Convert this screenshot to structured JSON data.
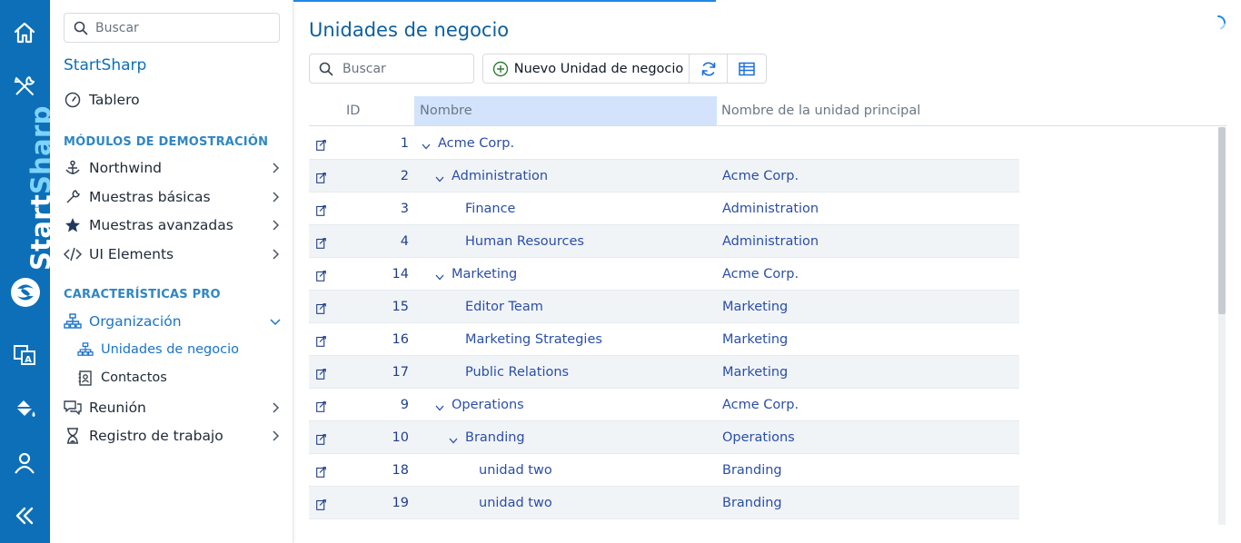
{
  "rail": {
    "brand_part1": "Start",
    "brand_part2": "Sharp",
    "icons": [
      "home-icon",
      "tools-icon",
      "translate-icon",
      "paint-bucket-icon",
      "user-icon",
      "collapse-icon"
    ]
  },
  "sidebar": {
    "search_placeholder": "Buscar",
    "app_name": "StartSharp",
    "dashboard": "Tablero",
    "section_demo": "MÓDULOS DE DEMOSTRACIÓN",
    "demo_items": [
      "Northwind",
      "Muestras básicas",
      "Muestras avanzadas",
      "UI Elements"
    ],
    "section_pro": "CARACTERÍSTICAS PRO",
    "org": "Organización",
    "org_items": [
      "Unidades de negocio",
      "Contactos"
    ],
    "pro_items": [
      "Reunión",
      "Registro de trabajo"
    ]
  },
  "page": {
    "title": "Unidades de negocio",
    "search_placeholder": "Buscar",
    "new_button": "Nuevo Unidad de negocio"
  },
  "grid": {
    "columns": [
      "ID",
      "Nombre",
      "Nombre de la unidad principal"
    ],
    "rows": [
      {
        "id": "1",
        "name": "Acme Corp.",
        "parent": "",
        "level": 0,
        "expander": true
      },
      {
        "id": "2",
        "name": "Administration",
        "parent": "Acme Corp.",
        "level": 1,
        "expander": true
      },
      {
        "id": "3",
        "name": "Finance",
        "parent": "Administration",
        "level": 2,
        "expander": false
      },
      {
        "id": "4",
        "name": "Human Resources",
        "parent": "Administration",
        "level": 2,
        "expander": false
      },
      {
        "id": "14",
        "name": "Marketing",
        "parent": "Acme Corp.",
        "level": 1,
        "expander": true
      },
      {
        "id": "15",
        "name": "Editor Team",
        "parent": "Marketing",
        "level": 2,
        "expander": false
      },
      {
        "id": "16",
        "name": "Marketing Strategies",
        "parent": "Marketing",
        "level": 2,
        "expander": false
      },
      {
        "id": "17",
        "name": "Public Relations",
        "parent": "Marketing",
        "level": 2,
        "expander": false
      },
      {
        "id": "9",
        "name": "Operations",
        "parent": "Acme Corp.",
        "level": 1,
        "expander": true
      },
      {
        "id": "10",
        "name": "Branding",
        "parent": "Operations",
        "level": 2,
        "expander": true
      },
      {
        "id": "18",
        "name": "unidad two",
        "parent": "Branding",
        "level": 3,
        "expander": false
      },
      {
        "id": "19",
        "name": "unidad two",
        "parent": "Branding",
        "level": 3,
        "expander": false
      }
    ]
  },
  "colors": {
    "rail": "#0d6fb8",
    "accent": "#1a73c9",
    "section": "#2f86c4",
    "link": "#2a4ea8",
    "sorted_header": "#d3e3fb"
  }
}
